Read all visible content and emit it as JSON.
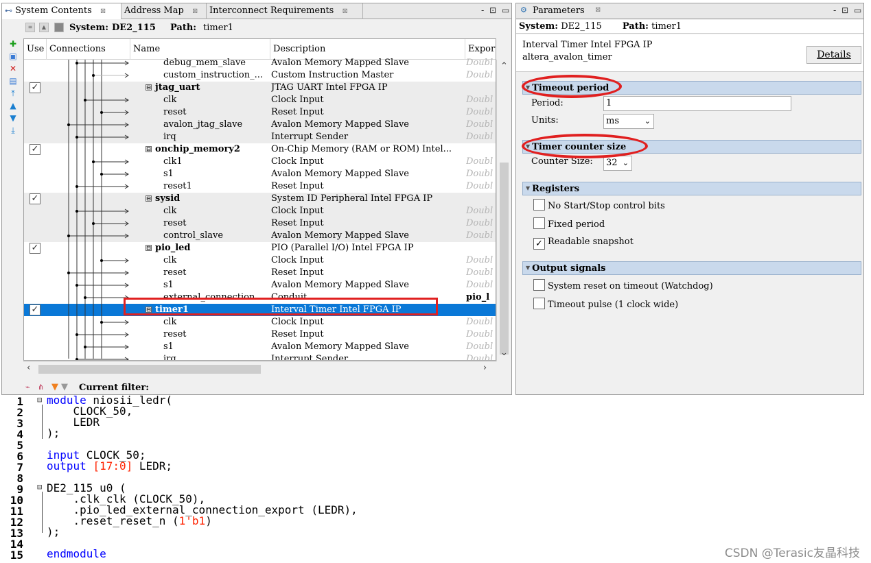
{
  "left_panel": {
    "tabs": [
      {
        "label": "System Contents",
        "close": "⊠"
      },
      {
        "label": "Address Map",
        "close": "⊠"
      },
      {
        "label": "Interconnect Requirements",
        "close": "⊠"
      }
    ],
    "window_controls": "- ⊡ ▭",
    "system_label": "System:",
    "system_value": "DE2_115",
    "path_label": "Path:",
    "path_value": "timer1",
    "columns": [
      "Use",
      "Connections",
      "Name",
      "Description",
      "Export"
    ],
    "rows": [
      {
        "name": "debug_mem_slave",
        "desc": "Avalon Memory Mapped Slave",
        "export": "Doubl"
      },
      {
        "name": "custom_instruction_...",
        "desc": "Custom Instruction Master",
        "export": "Doubl"
      },
      {
        "name": "jtag_uart",
        "desc": "JTAG UART Intel FPGA IP",
        "export": "",
        "use": "✓",
        "expander": "⊟"
      },
      {
        "name": "clk",
        "desc": "Clock Input",
        "export": "Doubl"
      },
      {
        "name": "reset",
        "desc": "Reset Input",
        "export": "Doubl"
      },
      {
        "name": "avalon_jtag_slave",
        "desc": "Avalon Memory Mapped Slave",
        "export": "Doubl"
      },
      {
        "name": "irq",
        "desc": "Interrupt Sender",
        "export": "Doubl"
      },
      {
        "name": "onchip_memory2",
        "desc": "On-Chip Memory (RAM or ROM) Intel...",
        "export": "",
        "use": "✓",
        "expander": "⊟"
      },
      {
        "name": "clk1",
        "desc": "Clock Input",
        "export": "Doubl"
      },
      {
        "name": "s1",
        "desc": "Avalon Memory Mapped Slave",
        "export": "Doubl"
      },
      {
        "name": "reset1",
        "desc": "Reset Input",
        "export": "Doubl"
      },
      {
        "name": "sysid",
        "desc": "System ID Peripheral Intel FPGA IP",
        "export": "",
        "use": "✓",
        "expander": "⊟"
      },
      {
        "name": "clk",
        "desc": "Clock Input",
        "export": "Doubl"
      },
      {
        "name": "reset",
        "desc": "Reset Input",
        "export": "Doubl"
      },
      {
        "name": "control_slave",
        "desc": "Avalon Memory Mapped Slave",
        "export": "Doubl"
      },
      {
        "name": "pio_led",
        "desc": "PIO (Parallel I/O) Intel FPGA IP",
        "export": "",
        "use": "✓",
        "expander": "⊟"
      },
      {
        "name": "clk",
        "desc": "Clock Input",
        "export": "Doubl"
      },
      {
        "name": "reset",
        "desc": "Reset Input",
        "export": "Doubl"
      },
      {
        "name": "s1",
        "desc": "Avalon Memory Mapped Slave",
        "export": "Doubl"
      },
      {
        "name": "external_connection",
        "desc": "Conduit",
        "export": "pio_l"
      },
      {
        "name": "timer1",
        "desc": "Interval Timer Intel FPGA IP",
        "export": "",
        "use": "✓",
        "expander": "⊟"
      },
      {
        "name": "clk",
        "desc": "Clock Input",
        "export": "Doubl"
      },
      {
        "name": "reset",
        "desc": "Reset Input",
        "export": "Doubl"
      },
      {
        "name": "s1",
        "desc": "Avalon Memory Mapped Slave",
        "export": "Doubl"
      },
      {
        "name": "irq",
        "desc": "Interrupt Sender",
        "export": "Doubl"
      }
    ],
    "filter_label": "Current filter:"
  },
  "right_panel": {
    "title": "Parameters",
    "close": "⊠",
    "window_controls": "- ⊡ ▭",
    "system_label": "System:",
    "system_value": "DE2_115",
    "path_label": "Path:",
    "path_value": "timer1",
    "ip_name": "Interval Timer Intel FPGA IP",
    "ip_id": "altera_avalon_timer",
    "details_label": "Details",
    "sections": {
      "timeout_period": "Timeout period",
      "timer_counter_size": "Timer counter size",
      "registers": "Registers",
      "output_signals": "Output signals"
    },
    "period_label": "Period:",
    "period_value": "1",
    "units_label": "Units:",
    "units_value": "ms",
    "counter_size_label": "Counter Size:",
    "counter_size_value": "32",
    "registers": [
      {
        "label": "No Start/Stop control bits",
        "checked": ""
      },
      {
        "label": "Fixed period",
        "checked": ""
      },
      {
        "label": "Readable snapshot",
        "checked": "✓"
      }
    ],
    "outputs": [
      {
        "label": "System reset on timeout (Watchdog)",
        "checked": ""
      },
      {
        "label": "Timeout pulse (1 clock wide)",
        "checked": ""
      }
    ]
  },
  "code": {
    "line_numbers": [
      "1",
      "2",
      "3",
      "4",
      "5",
      "6",
      "7",
      "8",
      "9",
      "10",
      "11",
      "12",
      "13",
      "14",
      "15"
    ],
    "l1_kw": "module",
    "l1_rest": " niosii_ledr(",
    "l2": "    CLOCK_50,",
    "l3": "    LEDR",
    "l4": ");",
    "l6_kw": "input",
    "l6_rest": " CLOCK_50;",
    "l7_kw": "output",
    "l7_num": "[17:0]",
    "l7_rest": " LEDR;",
    "l9": "DE2_115 u0 (",
    "l10": "    .clk_clk (CLOCK_50),",
    "l11": "    .pio_led_external_connection_export (LEDR),",
    "l12_a": "    .reset_reset_n (",
    "l12_num": "1'b1",
    "l12_b": ")",
    "l13": ");",
    "l15_kw": "endmodule",
    "watermark": "CSDN @Terasic友晶科技"
  },
  "colors": {
    "selection": "#0a78d7",
    "annotation_red": "#e02020",
    "section_header": "#c9d9ec",
    "keyword_blue": "#0000ff",
    "number_red": "#ff2200"
  }
}
